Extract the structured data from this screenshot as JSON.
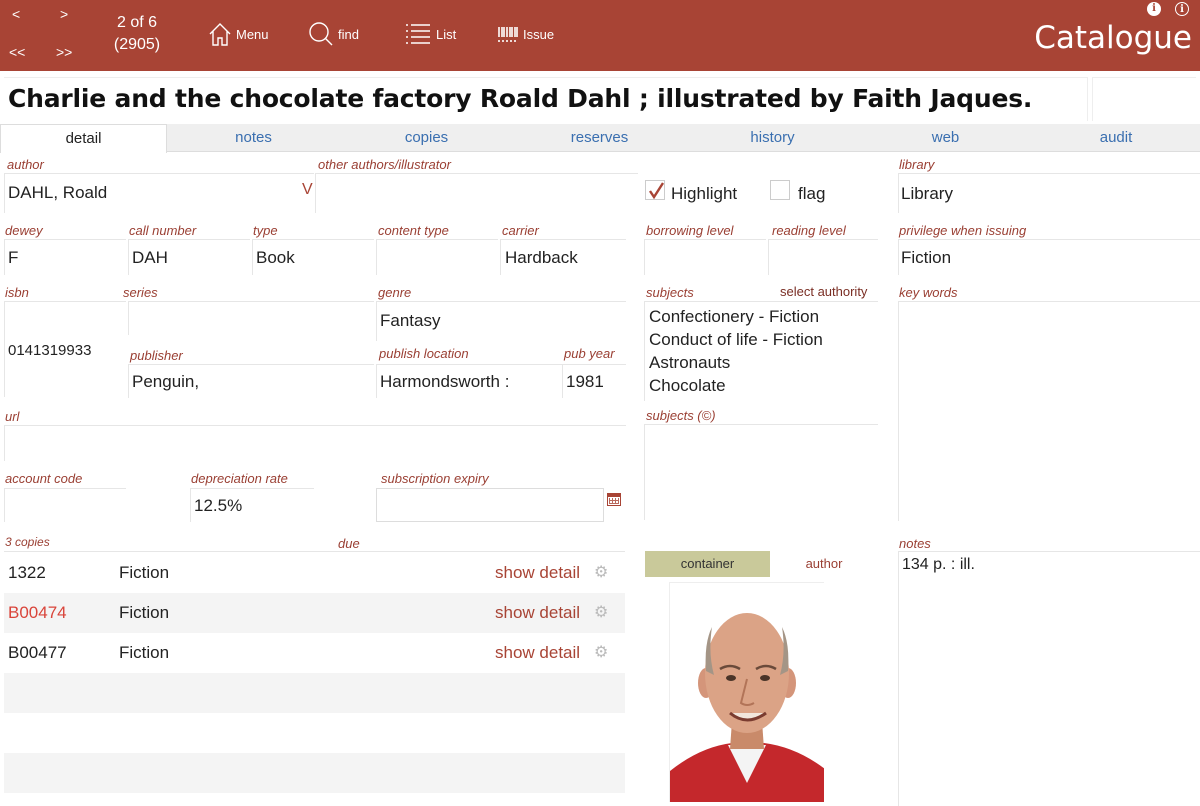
{
  "toolbar": {
    "prev": "<",
    "next": ">",
    "first": "<<",
    "last": ">>",
    "record_position": "2 of 6",
    "record_count": "(2905)",
    "menu_label": "Menu",
    "find_label": "find",
    "list_label": "List",
    "issue_label": "Issue",
    "app_title": "Catalogue"
  },
  "record": {
    "title": "Charlie and the chocolate factory Roald Dahl ; illustrated by Faith Jaques."
  },
  "tabs": [
    "detail",
    "notes",
    "copies",
    "reserves",
    "history",
    "web",
    "audit"
  ],
  "fields": {
    "author_label": "author",
    "author_value": "DAHL, Roald",
    "author_marker": "V",
    "other_authors_label": "other authors/illustrator",
    "highlight_label": "Highlight",
    "flag_label": "flag",
    "library_label": "library",
    "library_value": "Library",
    "dewey_label": "dewey",
    "dewey_value": "F",
    "call_number_label": "call number",
    "call_number_value": "DAH",
    "type_label": "type",
    "type_value": "Book",
    "content_type_label": "content type",
    "carrier_label": "carrier",
    "carrier_value": "Hardback",
    "borrowing_level_label": "borrowing level",
    "reading_level_label": "reading level",
    "privilege_label": "privilege when issuing",
    "privilege_value": "Fiction",
    "isbn_label": "isbn",
    "isbn_value": "0141319933",
    "series_label": "series",
    "genre_label": "genre",
    "genre_value": "Fantasy",
    "subjects_label": "subjects",
    "select_authority_label": "select authority",
    "key_words_label": "key words",
    "publisher_label": "publisher",
    "publisher_value": "Penguin,",
    "publish_location_label": "publish location",
    "publish_location_value": "Harmondsworth :",
    "pub_year_label": "pub year",
    "pub_year_value": "1981",
    "url_label": "url",
    "subjects_c_label": "subjects (©)",
    "account_code_label": "account code",
    "depreciation_rate_label": "depreciation rate",
    "depreciation_rate_value": "12.5%",
    "subscription_expiry_label": "subscription expiry",
    "notes_label": "notes",
    "notes_value": "134 p. : ill."
  },
  "subjects": [
    "Confectionery - Fiction",
    "Conduct of life - Fiction",
    "Astronauts",
    "Chocolate"
  ],
  "copies": {
    "count_label": "3 copies",
    "due_label": "due",
    "rows": [
      {
        "barcode": "1322",
        "location": "Fiction",
        "action": "show detail",
        "barcode_color": "#222222"
      },
      {
        "barcode": "B00474",
        "location": "Fiction",
        "action": "show detail",
        "barcode_color": "#d9443a"
      },
      {
        "barcode": "B00477",
        "location": "Fiction",
        "action": "show detail",
        "barcode_color": "#222222"
      }
    ]
  },
  "image_panel": {
    "container_label": "container",
    "author_label": "author"
  },
  "colors": {
    "header_bg": "#a84435",
    "label": "#9a3f33",
    "tab_link": "#3a6fb0",
    "container_bg": "#c9c99a"
  }
}
